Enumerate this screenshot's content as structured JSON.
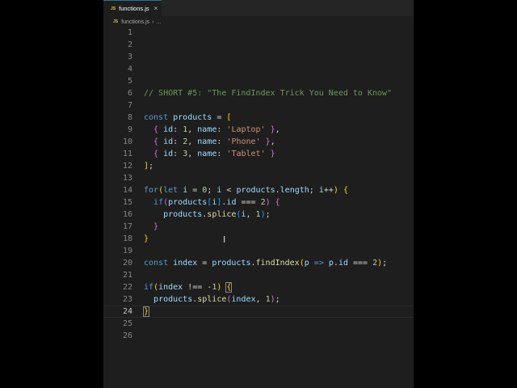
{
  "tab": {
    "icon": "JS",
    "label": "functions.js",
    "close": "×"
  },
  "breadcrumb": {
    "icon": "JS",
    "file": "functions.js",
    "sep": "›",
    "more": "..."
  },
  "current_line": 24,
  "lines": [
    [],
    [],
    [],
    [],
    [],
    [
      [
        "// SHORT #5: \"The FindIndex Trick You Need to Know\"",
        "c"
      ]
    ],
    [],
    [
      [
        "const",
        "k"
      ],
      [
        " ",
        "p"
      ],
      [
        "products",
        "v"
      ],
      [
        " = ",
        "p"
      ],
      [
        "[",
        "b1"
      ]
    ],
    [
      [
        "  ",
        "p"
      ],
      [
        "{",
        "b2"
      ],
      [
        " ",
        "p"
      ],
      [
        "id",
        "v"
      ],
      [
        ": ",
        "p"
      ],
      [
        "1",
        "n"
      ],
      [
        ", ",
        "p"
      ],
      [
        "name",
        "v"
      ],
      [
        ": ",
        "p"
      ],
      [
        "'Laptop'",
        "s"
      ],
      [
        " ",
        "p"
      ],
      [
        "}",
        "b2"
      ],
      [
        ",",
        "p"
      ]
    ],
    [
      [
        "  ",
        "p"
      ],
      [
        "{",
        "b2"
      ],
      [
        " ",
        "p"
      ],
      [
        "id",
        "v"
      ],
      [
        ": ",
        "p"
      ],
      [
        "2",
        "n"
      ],
      [
        ", ",
        "p"
      ],
      [
        "name",
        "v"
      ],
      [
        ": ",
        "p"
      ],
      [
        "'Phone'",
        "s"
      ],
      [
        " ",
        "p"
      ],
      [
        "}",
        "b2"
      ],
      [
        ",",
        "p"
      ]
    ],
    [
      [
        "  ",
        "p"
      ],
      [
        "{",
        "b2"
      ],
      [
        " ",
        "p"
      ],
      [
        "id",
        "v"
      ],
      [
        ": ",
        "p"
      ],
      [
        "3",
        "n"
      ],
      [
        ", ",
        "p"
      ],
      [
        "name",
        "v"
      ],
      [
        ": ",
        "p"
      ],
      [
        "'Tablet'",
        "s"
      ],
      [
        " ",
        "p"
      ],
      [
        "}",
        "b2"
      ]
    ],
    [
      [
        "]",
        "b1"
      ],
      [
        ";",
        "p"
      ]
    ],
    [],
    [
      [
        "for",
        "k"
      ],
      [
        "(",
        "b1"
      ],
      [
        "let",
        "k"
      ],
      [
        " ",
        "p"
      ],
      [
        "i",
        "v"
      ],
      [
        " = ",
        "p"
      ],
      [
        "0",
        "n"
      ],
      [
        "; ",
        "p"
      ],
      [
        "i",
        "v"
      ],
      [
        " < ",
        "p"
      ],
      [
        "products",
        "v"
      ],
      [
        ".",
        "p"
      ],
      [
        "length",
        "v"
      ],
      [
        "; ",
        "p"
      ],
      [
        "i",
        "v"
      ],
      [
        "++",
        "p"
      ],
      [
        ")",
        "b1"
      ],
      [
        " ",
        "p"
      ],
      [
        "{",
        "b1"
      ]
    ],
    [
      [
        "  ",
        "p"
      ],
      [
        "if",
        "k"
      ],
      [
        "(",
        "b2"
      ],
      [
        "products",
        "v"
      ],
      [
        "[",
        "b3"
      ],
      [
        "i",
        "v"
      ],
      [
        "]",
        "b3"
      ],
      [
        ".",
        "p"
      ],
      [
        "id",
        "v"
      ],
      [
        " === ",
        "p"
      ],
      [
        "2",
        "n"
      ],
      [
        ")",
        "b2"
      ],
      [
        " ",
        "p"
      ],
      [
        "{",
        "b2"
      ]
    ],
    [
      [
        "    ",
        "p"
      ],
      [
        "products",
        "v"
      ],
      [
        ".",
        "p"
      ],
      [
        "splice",
        "f"
      ],
      [
        "(",
        "b3"
      ],
      [
        "i",
        "v"
      ],
      [
        ", ",
        "p"
      ],
      [
        "1",
        "n"
      ],
      [
        ")",
        "b3"
      ],
      [
        ";",
        "p"
      ]
    ],
    [
      [
        "  ",
        "p"
      ],
      [
        "}",
        "b2"
      ]
    ],
    [
      [
        "}",
        "b1"
      ]
    ],
    [],
    [
      [
        "const",
        "k"
      ],
      [
        " ",
        "p"
      ],
      [
        "index",
        "v"
      ],
      [
        " = ",
        "p"
      ],
      [
        "products",
        "v"
      ],
      [
        ".",
        "p"
      ],
      [
        "findIndex",
        "f"
      ],
      [
        "(",
        "b1"
      ],
      [
        "p",
        "v"
      ],
      [
        " ",
        "p"
      ],
      [
        "=>",
        "k"
      ],
      [
        " ",
        "p"
      ],
      [
        "p",
        "v"
      ],
      [
        ".",
        "p"
      ],
      [
        "id",
        "v"
      ],
      [
        " === ",
        "p"
      ],
      [
        "2",
        "n"
      ],
      [
        ")",
        "b1"
      ],
      [
        ";",
        "p"
      ]
    ],
    [],
    [
      [
        "if",
        "k"
      ],
      [
        "(",
        "b1"
      ],
      [
        "index",
        "v"
      ],
      [
        " !== ",
        "p"
      ],
      [
        "-1",
        "n"
      ],
      [
        ")",
        "b1"
      ],
      [
        " ",
        "p"
      ],
      [
        "{",
        "b1 box"
      ]
    ],
    [
      [
        "  ",
        "p"
      ],
      [
        "products",
        "v"
      ],
      [
        ".",
        "p"
      ],
      [
        "splice",
        "f"
      ],
      [
        "(",
        "b2"
      ],
      [
        "index",
        "v"
      ],
      [
        ", ",
        "p"
      ],
      [
        "1",
        "n"
      ],
      [
        ")",
        "b2"
      ],
      [
        ";",
        "p"
      ]
    ],
    [
      [
        "}",
        "b1 box"
      ]
    ],
    [],
    []
  ],
  "colors": {
    "background": "#1e1e1e",
    "keyword": "#569cd6",
    "variable": "#9cdcfe",
    "function": "#dcdcaa",
    "string": "#ce9178",
    "number": "#b5cea8",
    "comment": "#6a9955"
  }
}
